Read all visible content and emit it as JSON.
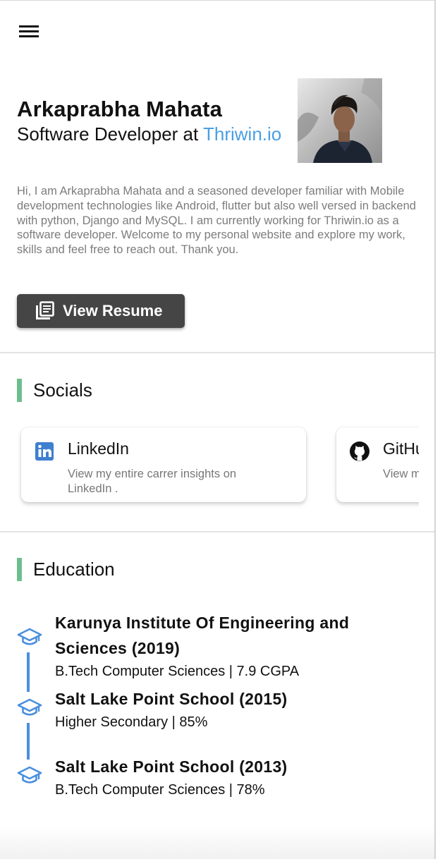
{
  "header": {
    "menu_icon": "hamburger-menu-icon"
  },
  "profile": {
    "name": "Arkaprabha Mahata",
    "role_prefix": "Software Developer at ",
    "company": "Thriwin.io",
    "company_color": "#4a9fe3",
    "bio": "Hi, I am Arkaprabha Mahata and a seasoned developer familiar with Mobile development technologies like Android, flutter but also well versed in backend with python, Django  and MySQL. I am currently working for Thriwin.io as a software developer. Welcome to my personal website and explore my work, skills and feel free to reach out. Thank you.",
    "resume_label": "View Resume",
    "resume_icon": "document-icon"
  },
  "socials": {
    "title": "Socials",
    "accent": "#6ebd8f",
    "items": [
      {
        "icon": "linkedin-icon",
        "title": "LinkedIn",
        "desc": "View my entire carrer insights on LinkedIn ."
      },
      {
        "icon": "github-icon",
        "title": "GitHub",
        "desc": "View my work available"
      }
    ]
  },
  "education": {
    "title": "Education",
    "icon": "graduation-cap-icon",
    "line_color": "#4a8fdf",
    "items": [
      {
        "title": "Karunya Institute Of Engineering and Sciences (2019)",
        "subtitle": "B.Tech Computer Sciences | 7.9 CGPA"
      },
      {
        "title": "Salt Lake Point School (2015)",
        "subtitle": "Higher Secondary | 85%"
      },
      {
        "title": "Salt Lake Point School (2013)",
        "subtitle": "B.Tech Computer Sciences | 78%"
      }
    ]
  }
}
